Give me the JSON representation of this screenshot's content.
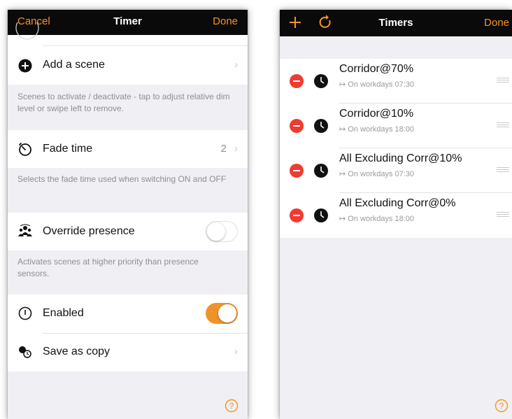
{
  "left": {
    "nav": {
      "cancel": "Cancel",
      "title": "Timer",
      "done": "Done"
    },
    "add_scene": {
      "label": "Add a scene"
    },
    "scenes_footer": "Scenes to activate / deactivate - tap to adjust relative dim level or swipe left to remove.",
    "fade_time": {
      "label": "Fade time",
      "value": "2"
    },
    "fade_footer": "Selects the fade time used when switching ON and OFF",
    "override": {
      "label": "Override presence",
      "on": false
    },
    "override_footer": "Activates scenes at higher priority than presence sensors.",
    "enabled": {
      "label": "Enabled",
      "on": true
    },
    "save_copy": {
      "label": "Save as copy"
    }
  },
  "right": {
    "nav": {
      "title": "Timers",
      "done": "Done"
    },
    "timers": [
      {
        "name": "Corridor@70%",
        "schedule": "↦ On workdays 07:30"
      },
      {
        "name": "Corridor@10%",
        "schedule": "↦ On workdays 18:00"
      },
      {
        "name": "All Excluding Corr@10%",
        "schedule": "↦ On workdays 07:30"
      },
      {
        "name": "All Excluding Corr@0%",
        "schedule": "↦ On workdays 18:00"
      }
    ]
  },
  "colors": {
    "accent": "#f7941d",
    "toggle_on": "#f0922a",
    "delete": "#ef3b30",
    "navbar": "#0a0a0a",
    "group_bg": "#efeff4"
  },
  "icons": [
    "add-circle-icon",
    "timer-icon",
    "people-icon",
    "power-icon",
    "copy-icon",
    "chevron-right-icon",
    "help-icon",
    "plus-icon",
    "refresh-icon",
    "clock-icon",
    "delete-icon",
    "drag-handle-icon"
  ]
}
